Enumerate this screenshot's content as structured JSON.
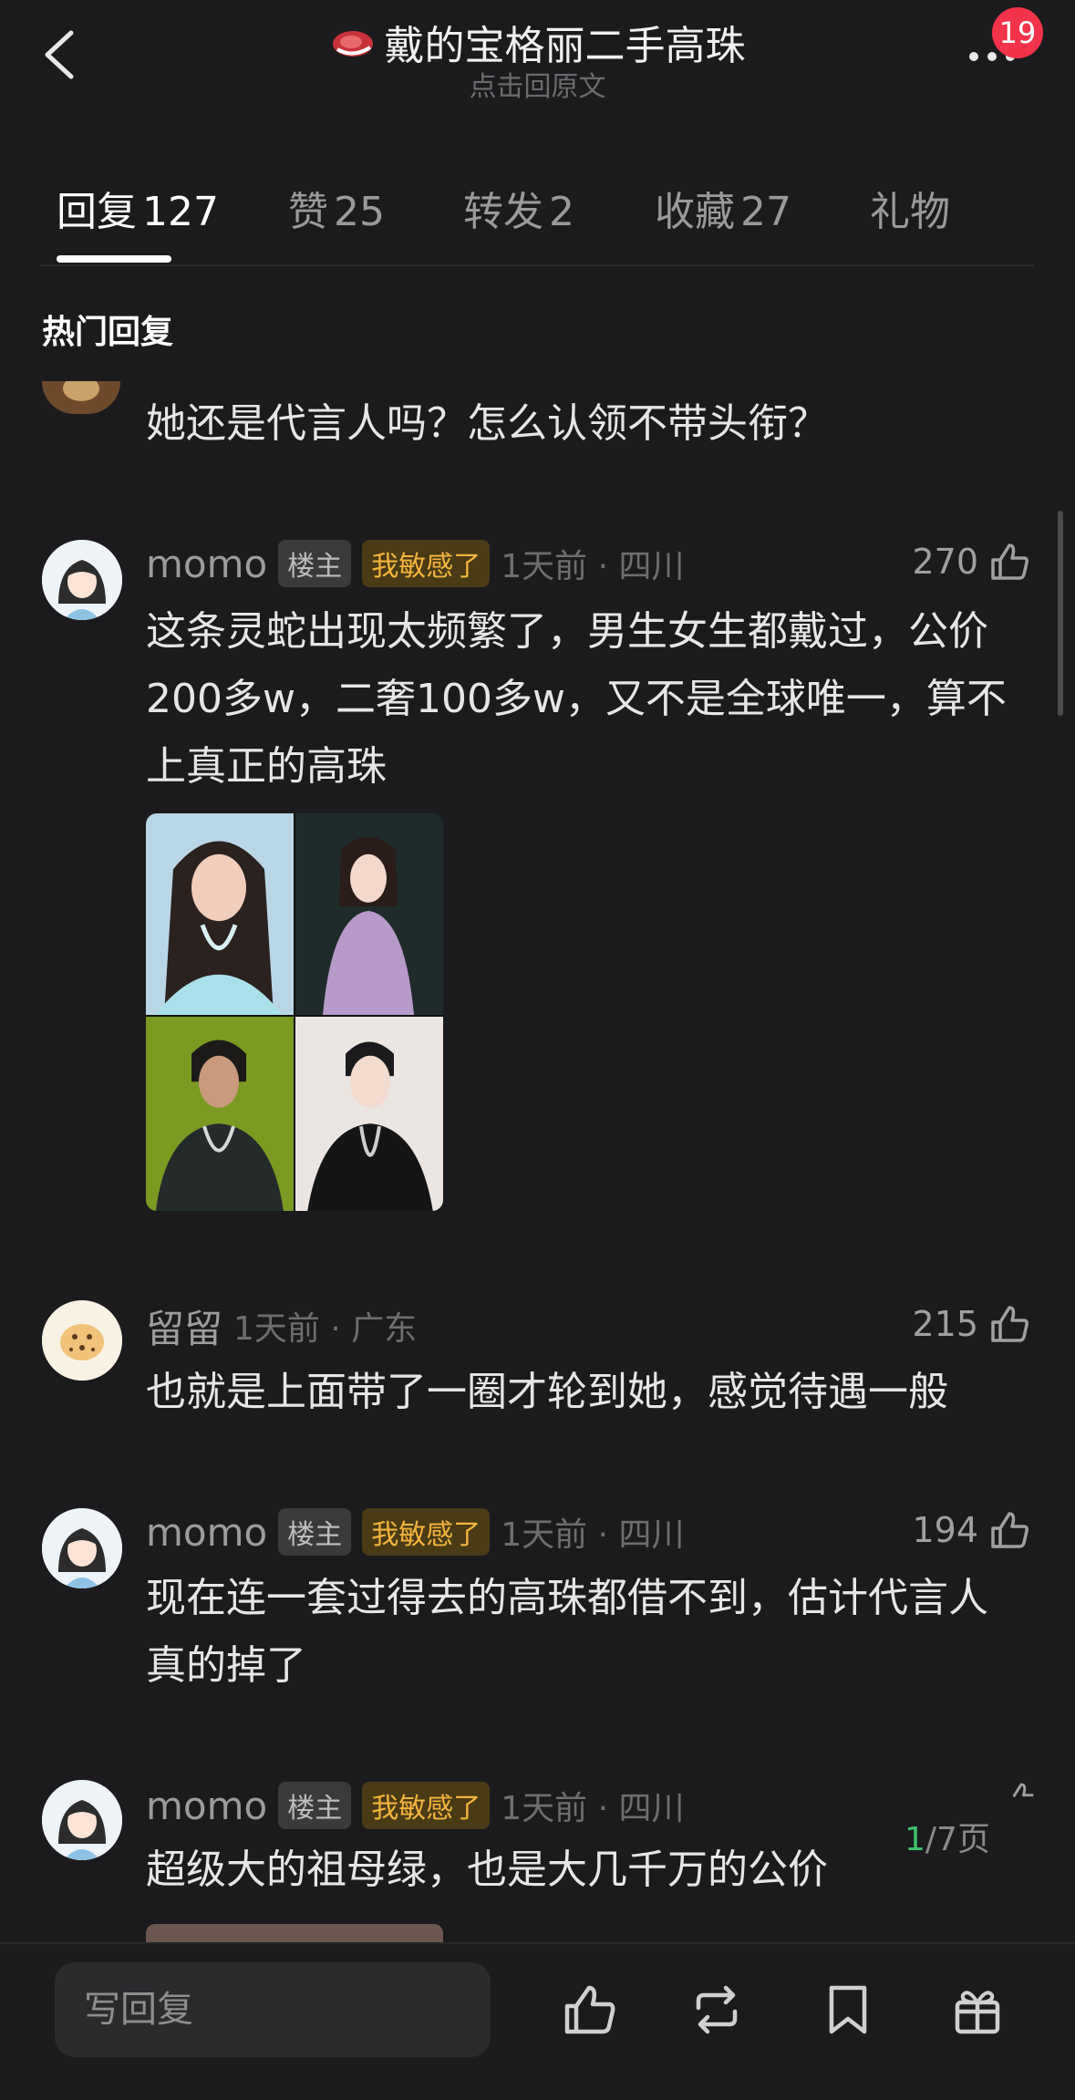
{
  "header": {
    "title": "戴的宝格丽二手高珠",
    "subtitle": "点击回原文",
    "badge_count": "19",
    "icons": {
      "back": "back-arrow-icon",
      "title": "steak-emoji-icon",
      "more": "more-dots-icon"
    }
  },
  "tabs": [
    {
      "label": "回复",
      "count": "127",
      "active": true
    },
    {
      "label": "赞",
      "count": "25"
    },
    {
      "label": "转发",
      "count": "2"
    },
    {
      "label": "收藏",
      "count": "27"
    },
    {
      "label": "礼物",
      "count": ""
    }
  ],
  "section_title": "热门回复",
  "partial_comment": {
    "text": "她还是代言人吗？怎么认领不带头衔？"
  },
  "comments": [
    {
      "user": "momo",
      "owner_tag": "楼主",
      "flair": "我敏感了",
      "meta": "1天前 · 四川",
      "likes": "270",
      "text": "这条灵蛇出现太频繁了，男生女生都戴过，公价200多w，二奢100多w，又不是全球唯一，算不上真正的高珠"
    },
    {
      "user": "留留",
      "meta": "1天前 · 广东",
      "likes": "215",
      "text": "也就是上面带了一圈才轮到她，感觉待遇一般"
    },
    {
      "user": "momo",
      "owner_tag": "楼主",
      "flair": "我敏感了",
      "meta": "1天前 · 四川",
      "likes": "194",
      "text": "现在连一套过得去的高珠都借不到，估计代言人真的掉了"
    },
    {
      "user": "momo",
      "owner_tag": "楼主",
      "flair": "我敏感了",
      "meta": "1天前 · 四川",
      "text": "超级大的祖母绿，也是大几千万的公价"
    }
  ],
  "pager": {
    "current": "1",
    "total": "/7页"
  },
  "bottom_bar": {
    "reply_placeholder": "写回复",
    "icons": [
      "thumbs-up-icon",
      "repost-icon",
      "bookmark-icon",
      "gift-icon"
    ]
  },
  "colors": {
    "background": "#1b1b1d",
    "badge": "#f2334a",
    "flair_text": "#f2b53c",
    "pager_current": "#3fc06a"
  }
}
